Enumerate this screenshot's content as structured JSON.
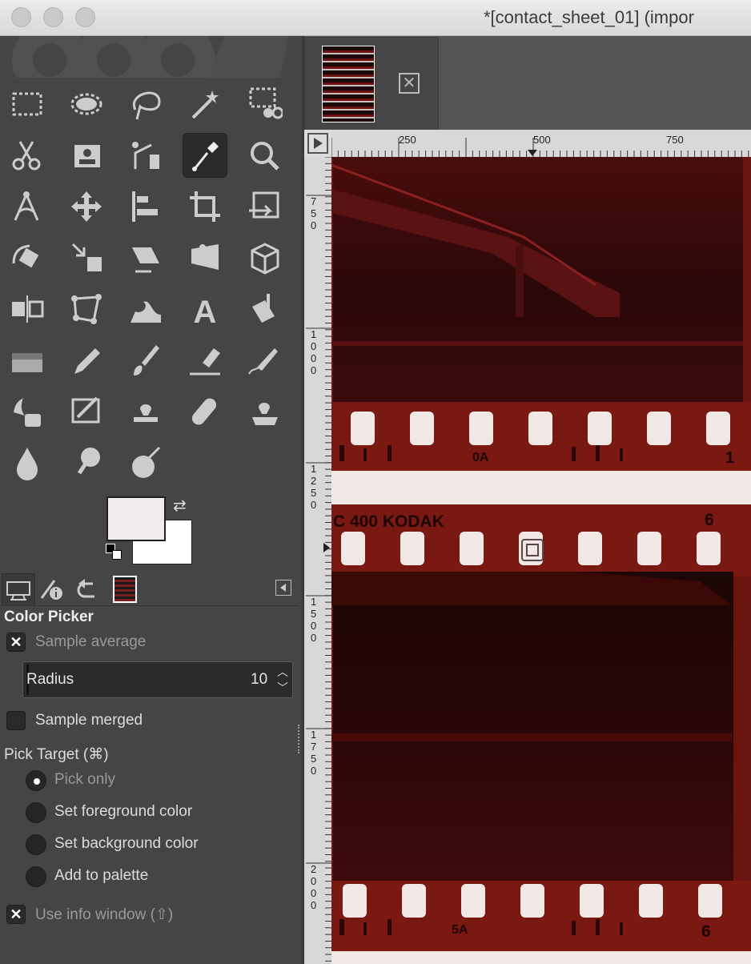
{
  "window": {
    "title": "*[contact_sheet_01] (impor"
  },
  "toolbox": {
    "tools": [
      {
        "name": "rect-select"
      },
      {
        "name": "ellipse-select"
      },
      {
        "name": "free-select"
      },
      {
        "name": "fuzzy-select"
      },
      {
        "name": "select-by-color"
      },
      {
        "name": "scissors-select"
      },
      {
        "name": "foreground-select"
      },
      {
        "name": "paths"
      },
      {
        "name": "color-picker"
      },
      {
        "name": "zoom"
      },
      {
        "name": "measure"
      },
      {
        "name": "move"
      },
      {
        "name": "align"
      },
      {
        "name": "crop"
      },
      {
        "name": "unified-transform"
      },
      {
        "name": "rotate"
      },
      {
        "name": "scale"
      },
      {
        "name": "shear"
      },
      {
        "name": "perspective"
      },
      {
        "name": "3d-transform"
      },
      {
        "name": "flip"
      },
      {
        "name": "cage-transform"
      },
      {
        "name": "warp-transform"
      },
      {
        "name": "text"
      },
      {
        "name": "bucket-fill"
      },
      {
        "name": "gradient"
      },
      {
        "name": "pencil"
      },
      {
        "name": "paintbrush"
      },
      {
        "name": "eraser"
      },
      {
        "name": "airbrush"
      },
      {
        "name": "ink"
      },
      {
        "name": "mypaint-brush"
      },
      {
        "name": "clone"
      },
      {
        "name": "heal"
      },
      {
        "name": "perspective-clone"
      },
      {
        "name": "blur-sharpen"
      },
      {
        "name": "smudge"
      },
      {
        "name": "dodge-burn"
      }
    ],
    "active_tool": "color-picker",
    "foreground_color": "#f2ecec",
    "background_color": "#ffffff"
  },
  "dock": {
    "tabs": [
      "tool-options",
      "device-status",
      "undo-history",
      "images"
    ],
    "panel_title": "Color Picker",
    "sample_average": {
      "label": "Sample average",
      "checked": true
    },
    "radius": {
      "label": "Radius",
      "value": "10"
    },
    "sample_merged": {
      "label": "Sample merged",
      "checked": false
    },
    "pick_target": {
      "label": "Pick Target  (⌘)",
      "options": [
        {
          "label": "Pick only",
          "selected": true
        },
        {
          "label": "Set foreground color",
          "selected": false
        },
        {
          "label": "Set background color",
          "selected": false
        },
        {
          "label": "Add to palette",
          "selected": false
        }
      ]
    },
    "use_info_window": {
      "label": "Use info window  (⇧)",
      "checked": true
    }
  },
  "canvas": {
    "ruler_h_labels": [
      "250",
      "500",
      "750"
    ],
    "ruler_v_labels": [
      "750",
      "1000",
      "1250",
      "1500",
      "1750",
      "2000"
    ],
    "film_text": {
      "frame_0a": "0A",
      "frame_1": "1",
      "brand": "C 400  KODAK",
      "frame_6": "6",
      "frame_5a": "5A",
      "frame_6b": "6"
    }
  }
}
